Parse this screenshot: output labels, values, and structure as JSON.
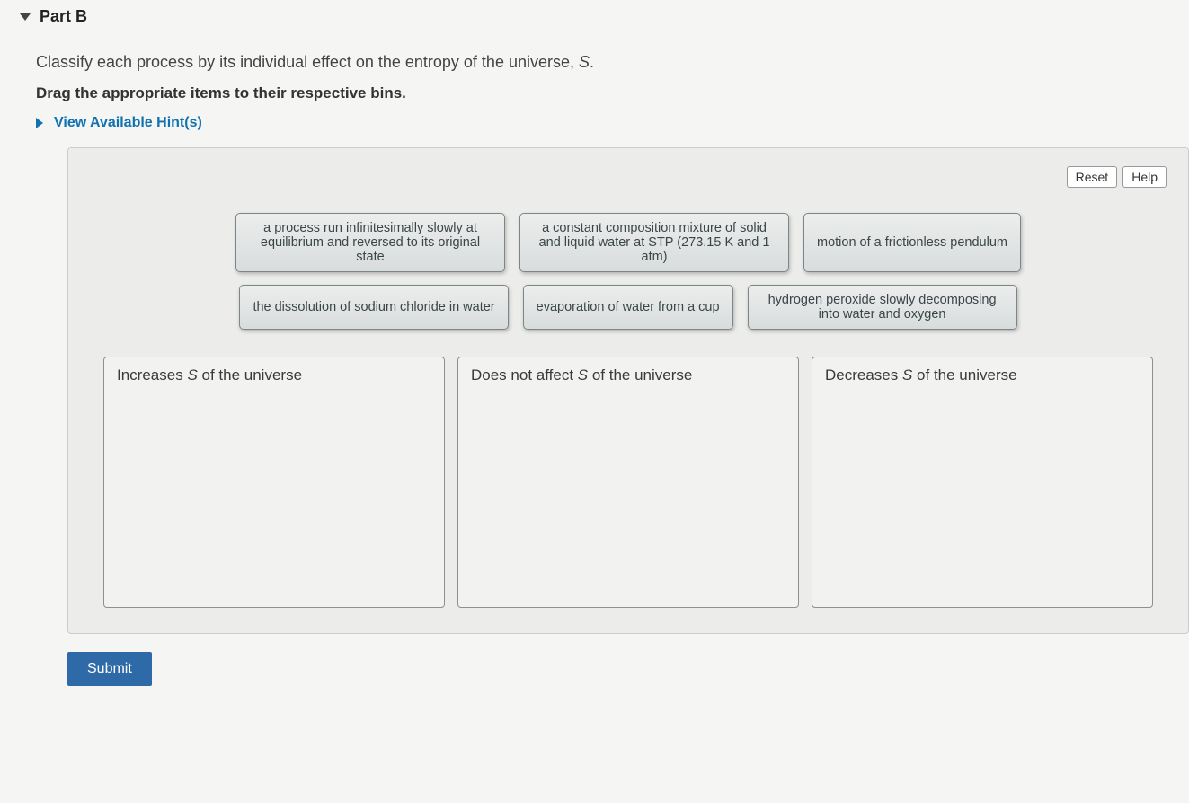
{
  "header": {
    "part_label": "Part B"
  },
  "prompt": {
    "line1_pre": "Classify each process by its individual effect on the entropy of the universe, ",
    "line1_var": "S",
    "line1_post": ".",
    "line2": "Drag the appropriate items to their respective bins.",
    "hints_label": "View Available Hint(s)"
  },
  "toolbar": {
    "reset": "Reset",
    "help": "Help"
  },
  "items": [
    "a process run infinitesimally slowly at equilibrium and reversed to its original state",
    "a constant composition mixture of solid and liquid water at STP (273.15 K and 1 atm)",
    "motion of a frictionless pendulum",
    "the dissolution of sodium chloride in water",
    "evaporation of water from a cup",
    "hydrogen peroxide slowly decomposing into water and oxygen"
  ],
  "bins": {
    "a_pre": "Increases ",
    "a_var": "S",
    "a_post": " of the universe",
    "b_pre": "Does not affect ",
    "b_var": "S",
    "b_post": " of the universe",
    "c_pre": "Decreases ",
    "c_var": "S",
    "c_post": " of the universe"
  },
  "actions": {
    "submit": "Submit"
  }
}
